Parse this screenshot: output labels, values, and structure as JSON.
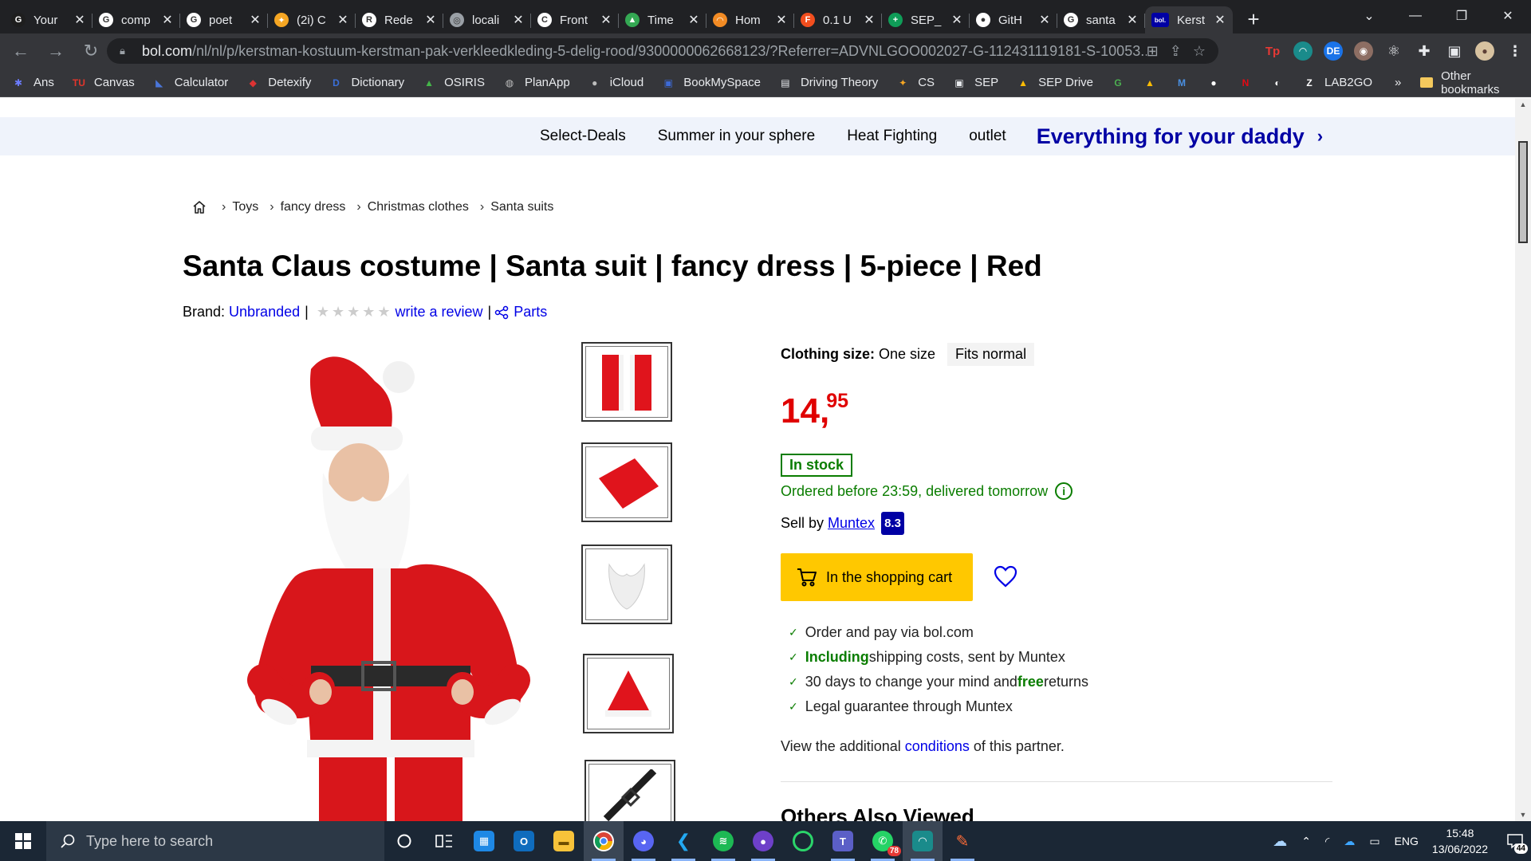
{
  "browser": {
    "tabs": [
      {
        "title": "Your",
        "fav_color": "#1e1e1e",
        "fav_glyph": "G"
      },
      {
        "title": "comp",
        "fav_color": "#ffffff",
        "fav_glyph": "G"
      },
      {
        "title": "poet",
        "fav_color": "#ffffff",
        "fav_glyph": "G"
      },
      {
        "title": "(2i) C",
        "fav_color": "#f5a623",
        "fav_glyph": "✦"
      },
      {
        "title": "Rede",
        "fav_color": "#ffffff",
        "fav_glyph": "R"
      },
      {
        "title": "locali",
        "fav_color": "#9aa0a6",
        "fav_glyph": "◎"
      },
      {
        "title": "Front",
        "fav_color": "#ffffff",
        "fav_glyph": "C"
      },
      {
        "title": "Time",
        "fav_color": "#34a853",
        "fav_glyph": "▲"
      },
      {
        "title": "Hom",
        "fav_color": "#f28b24",
        "fav_glyph": "◠"
      },
      {
        "title": "0.1 U",
        "fav_color": "#f24e1e",
        "fav_glyph": "F"
      },
      {
        "title": "SEP_",
        "fav_color": "#0f9d58",
        "fav_glyph": "+"
      },
      {
        "title": "GitH",
        "fav_color": "#ffffff",
        "fav_glyph": "●"
      },
      {
        "title": "santa",
        "fav_color": "#ffffff",
        "fav_glyph": "G"
      },
      {
        "title": "Kerst",
        "fav_color": "#0000a4",
        "fav_glyph": "bol."
      }
    ],
    "url_host": "bol.com",
    "url_path": "/nl/nl/p/kerstman-kostuum-kerstman-pak-verkleedkleding-5-delig-rood/9300000062668123/?Referrer=ADVNLGOO002027-G-112431119181-S-10053...",
    "bookmarks": [
      {
        "label": "Ans",
        "icon": "✱",
        "color": "#6c7cff"
      },
      {
        "label": "Canvas",
        "icon": "TU",
        "color": "#e2352b"
      },
      {
        "label": "Calculator",
        "icon": "◣",
        "color": "#4a76d9"
      },
      {
        "label": "Detexify",
        "icon": "◆",
        "color": "#d33"
      },
      {
        "label": "Dictionary",
        "icon": "D",
        "color": "#3a6fd8"
      },
      {
        "label": "OSIRIS",
        "icon": "▲",
        "color": "#44b649"
      },
      {
        "label": "PlanApp",
        "icon": "◍",
        "color": "#bdbdbd"
      },
      {
        "label": "iCloud",
        "icon": "●",
        "color": "#bdbdbd"
      },
      {
        "label": "BookMySpace",
        "icon": "▣",
        "color": "#3d6ad6"
      },
      {
        "label": "Driving Theory",
        "icon": "▤",
        "color": "#e8eaed"
      },
      {
        "label": "CS",
        "icon": "✦",
        "color": "#f5a623"
      },
      {
        "label": "SEP",
        "icon": "▣",
        "color": "#e8eaed"
      },
      {
        "label": "SEP Drive",
        "icon": "▲",
        "color": "#fbbc04"
      }
    ],
    "bookmark_icons_only": [
      {
        "name": "g-icon",
        "icon": "G",
        "color": "#4caf50"
      },
      {
        "name": "drive-icon",
        "icon": "▲",
        "color": "#fbbc04"
      },
      {
        "name": "m-icon",
        "icon": "M",
        "color": "#4a90e2"
      },
      {
        "name": "github-icon",
        "icon": "●",
        "color": "#ffffff"
      },
      {
        "name": "netflix-icon",
        "icon": "N",
        "color": "#e50914"
      },
      {
        "name": "s-icon",
        "icon": "◐",
        "color": "#ffffff"
      },
      {
        "name": "z-icon",
        "icon": "Z",
        "color": "#ffffff"
      }
    ],
    "lab2go_label": "LAB2GO",
    "more_bookmarks": "»",
    "other_bookmarks": "Other bookmarks"
  },
  "site": {
    "deals": [
      "Select-Deals",
      "Summer in your sphere",
      "Heat Fighting",
      "outlet"
    ],
    "promo": "Everything for your daddy",
    "breadcrumb": [
      "Toys",
      "fancy dress",
      "Christmas clothes",
      "Santa suits"
    ]
  },
  "product": {
    "title": "Santa Claus costume | Santa suit | fancy dress | 5-piece | Red",
    "brand_label": "Brand:",
    "brand": "Unbranded",
    "review_link": "write a review",
    "parts_link": "Parts",
    "rating_stars": 0,
    "size_label": "Clothing size:",
    "size_value": "One size",
    "fit": "Fits normal",
    "price_whole": "14",
    "price_cents": "95",
    "stock": "In stock",
    "delivery": "Ordered before 23:59, delivered tomorrow",
    "seller_prefix": "Sell by",
    "seller": "Muntex",
    "seller_score": "8.3",
    "cart_button": "In the shopping cart",
    "usps": [
      {
        "bold": "",
        "text": "Order and pay via bol.com"
      },
      {
        "bold": "Including",
        "text": " shipping costs, sent by Muntex"
      },
      {
        "bold": "",
        "text": "30 days to change your mind and "
      },
      {
        "bold": "",
        "text": "Legal guarantee through Muntex"
      }
    ],
    "usp3_bold": "free",
    "usp3_tail": " returns",
    "conditions_pre": "View the additional ",
    "conditions_link": "conditions",
    "conditions_post": " of this partner.",
    "also_viewed": "Others Also Viewed"
  },
  "taskbar": {
    "search_placeholder": "Type here to search",
    "language": "ENG",
    "time": "15:48",
    "date": "13/06/2022",
    "notifications": "44",
    "whatsapp_badge": "78"
  }
}
